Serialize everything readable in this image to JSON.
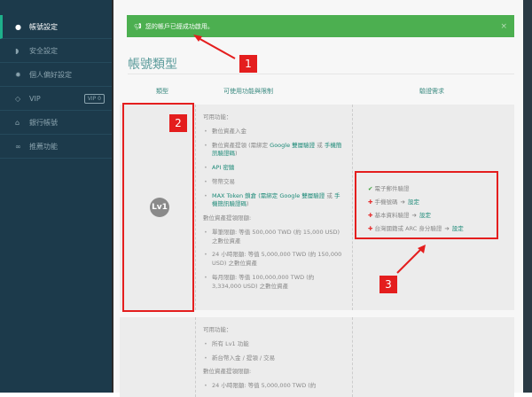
{
  "sidebar": {
    "items": [
      {
        "label": "帳號設定",
        "icon": "user-icon"
      },
      {
        "label": "安全設定",
        "icon": "shield-icon"
      },
      {
        "label": "個人偏好設定",
        "icon": "gear-icon"
      },
      {
        "label": "VIP",
        "icon": "diamond-icon",
        "badge": "VIP 0"
      },
      {
        "label": "銀行帳號",
        "icon": "bank-icon"
      },
      {
        "label": "推薦功能",
        "icon": "link-icon"
      }
    ]
  },
  "alert": {
    "message": "您的帳戶已經成功啟用。",
    "close": "×"
  },
  "page_title": "帳號類型",
  "headers": {
    "type": "類型",
    "features": "可使用功能與限制",
    "verify": "驗證需求"
  },
  "level1": {
    "badge": "Lv1",
    "features_title": "可用功能：",
    "features": [
      {
        "text": "數位資產入金"
      },
      {
        "text": "數位資產提領 (需綁定 ",
        "g1": "Google 雙層驗證",
        "mid": " 或 ",
        "g2": "手機簡訊驗證碼",
        "end": ")"
      },
      {
        "text": "API 密鑰"
      },
      {
        "text": "幣幣交易"
      },
      {
        "text": "MAX Token 鎖倉 (需綁定 ",
        "g1": "Google 雙層驗證",
        "mid": " 或 ",
        "g2": "手機簡訊驗證碼",
        "end": ")"
      }
    ],
    "limits_title": "數位資產提領限額:",
    "limits": [
      "單筆限額: 等值 500,000 TWD (約 15,000 USD) 之數位資產",
      "24 小時限額: 等值 5,000,000 TWD (約 150,000 USD) 之數位資產",
      "每月限額: 等值 100,000,000 TWD (約 3,334,000 USD) 之數位資產"
    ],
    "verify": [
      {
        "label": "電子郵件驗證",
        "done": true
      },
      {
        "label": "手機號碼",
        "done": false,
        "action": "設定"
      },
      {
        "label": "基本資料驗證",
        "done": false,
        "action": "設定"
      },
      {
        "label": "台灣國籍或 ARC 身分驗證",
        "done": false,
        "action": "設定"
      }
    ]
  },
  "level2": {
    "features_title": "可用功能：",
    "features": [
      "所有 Lv1 功能",
      "新台幣入金 / 提領 / 交易"
    ],
    "limits_title": "數位資產提領限額:",
    "limits": [
      "24 小時限額: 等值 5,000,000 TWD (約"
    ]
  },
  "annotations": [
    "1",
    "2",
    "3"
  ],
  "colors": {
    "sidebar": "#1c3a4b",
    "alert": "#4caf50",
    "accent": "#1d8a78",
    "annotation": "#e41e1e"
  }
}
